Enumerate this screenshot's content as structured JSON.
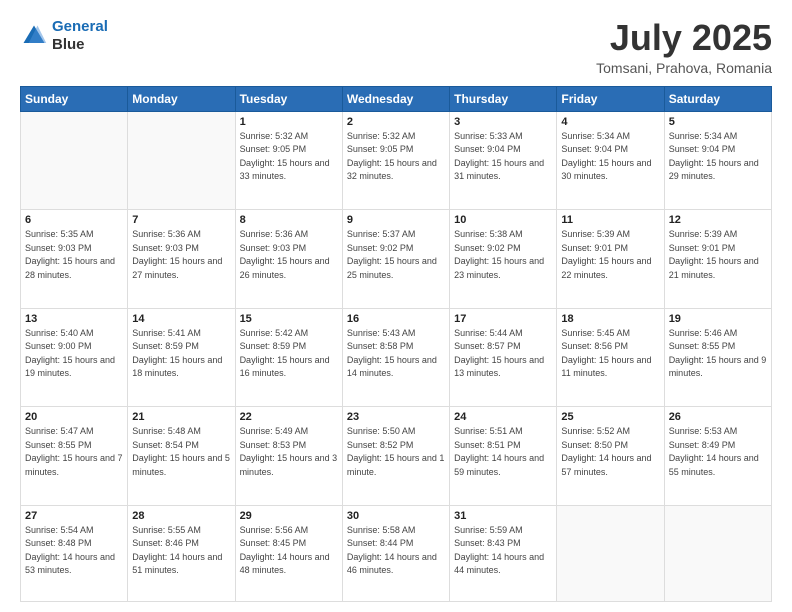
{
  "header": {
    "logo_line1": "General",
    "logo_line2": "Blue",
    "month": "July 2025",
    "location": "Tomsani, Prahova, Romania"
  },
  "weekdays": [
    "Sunday",
    "Monday",
    "Tuesday",
    "Wednesday",
    "Thursday",
    "Friday",
    "Saturday"
  ],
  "weeks": [
    [
      {
        "day": "",
        "sunrise": "",
        "sunset": "",
        "daylight": ""
      },
      {
        "day": "",
        "sunrise": "",
        "sunset": "",
        "daylight": ""
      },
      {
        "day": "1",
        "sunrise": "Sunrise: 5:32 AM",
        "sunset": "Sunset: 9:05 PM",
        "daylight": "Daylight: 15 hours and 33 minutes."
      },
      {
        "day": "2",
        "sunrise": "Sunrise: 5:32 AM",
        "sunset": "Sunset: 9:05 PM",
        "daylight": "Daylight: 15 hours and 32 minutes."
      },
      {
        "day": "3",
        "sunrise": "Sunrise: 5:33 AM",
        "sunset": "Sunset: 9:04 PM",
        "daylight": "Daylight: 15 hours and 31 minutes."
      },
      {
        "day": "4",
        "sunrise": "Sunrise: 5:34 AM",
        "sunset": "Sunset: 9:04 PM",
        "daylight": "Daylight: 15 hours and 30 minutes."
      },
      {
        "day": "5",
        "sunrise": "Sunrise: 5:34 AM",
        "sunset": "Sunset: 9:04 PM",
        "daylight": "Daylight: 15 hours and 29 minutes."
      }
    ],
    [
      {
        "day": "6",
        "sunrise": "Sunrise: 5:35 AM",
        "sunset": "Sunset: 9:03 PM",
        "daylight": "Daylight: 15 hours and 28 minutes."
      },
      {
        "day": "7",
        "sunrise": "Sunrise: 5:36 AM",
        "sunset": "Sunset: 9:03 PM",
        "daylight": "Daylight: 15 hours and 27 minutes."
      },
      {
        "day": "8",
        "sunrise": "Sunrise: 5:36 AM",
        "sunset": "Sunset: 9:03 PM",
        "daylight": "Daylight: 15 hours and 26 minutes."
      },
      {
        "day": "9",
        "sunrise": "Sunrise: 5:37 AM",
        "sunset": "Sunset: 9:02 PM",
        "daylight": "Daylight: 15 hours and 25 minutes."
      },
      {
        "day": "10",
        "sunrise": "Sunrise: 5:38 AM",
        "sunset": "Sunset: 9:02 PM",
        "daylight": "Daylight: 15 hours and 23 minutes."
      },
      {
        "day": "11",
        "sunrise": "Sunrise: 5:39 AM",
        "sunset": "Sunset: 9:01 PM",
        "daylight": "Daylight: 15 hours and 22 minutes."
      },
      {
        "day": "12",
        "sunrise": "Sunrise: 5:39 AM",
        "sunset": "Sunset: 9:01 PM",
        "daylight": "Daylight: 15 hours and 21 minutes."
      }
    ],
    [
      {
        "day": "13",
        "sunrise": "Sunrise: 5:40 AM",
        "sunset": "Sunset: 9:00 PM",
        "daylight": "Daylight: 15 hours and 19 minutes."
      },
      {
        "day": "14",
        "sunrise": "Sunrise: 5:41 AM",
        "sunset": "Sunset: 8:59 PM",
        "daylight": "Daylight: 15 hours and 18 minutes."
      },
      {
        "day": "15",
        "sunrise": "Sunrise: 5:42 AM",
        "sunset": "Sunset: 8:59 PM",
        "daylight": "Daylight: 15 hours and 16 minutes."
      },
      {
        "day": "16",
        "sunrise": "Sunrise: 5:43 AM",
        "sunset": "Sunset: 8:58 PM",
        "daylight": "Daylight: 15 hours and 14 minutes."
      },
      {
        "day": "17",
        "sunrise": "Sunrise: 5:44 AM",
        "sunset": "Sunset: 8:57 PM",
        "daylight": "Daylight: 15 hours and 13 minutes."
      },
      {
        "day": "18",
        "sunrise": "Sunrise: 5:45 AM",
        "sunset": "Sunset: 8:56 PM",
        "daylight": "Daylight: 15 hours and 11 minutes."
      },
      {
        "day": "19",
        "sunrise": "Sunrise: 5:46 AM",
        "sunset": "Sunset: 8:55 PM",
        "daylight": "Daylight: 15 hours and 9 minutes."
      }
    ],
    [
      {
        "day": "20",
        "sunrise": "Sunrise: 5:47 AM",
        "sunset": "Sunset: 8:55 PM",
        "daylight": "Daylight: 15 hours and 7 minutes."
      },
      {
        "day": "21",
        "sunrise": "Sunrise: 5:48 AM",
        "sunset": "Sunset: 8:54 PM",
        "daylight": "Daylight: 15 hours and 5 minutes."
      },
      {
        "day": "22",
        "sunrise": "Sunrise: 5:49 AM",
        "sunset": "Sunset: 8:53 PM",
        "daylight": "Daylight: 15 hours and 3 minutes."
      },
      {
        "day": "23",
        "sunrise": "Sunrise: 5:50 AM",
        "sunset": "Sunset: 8:52 PM",
        "daylight": "Daylight: 15 hours and 1 minute."
      },
      {
        "day": "24",
        "sunrise": "Sunrise: 5:51 AM",
        "sunset": "Sunset: 8:51 PM",
        "daylight": "Daylight: 14 hours and 59 minutes."
      },
      {
        "day": "25",
        "sunrise": "Sunrise: 5:52 AM",
        "sunset": "Sunset: 8:50 PM",
        "daylight": "Daylight: 14 hours and 57 minutes."
      },
      {
        "day": "26",
        "sunrise": "Sunrise: 5:53 AM",
        "sunset": "Sunset: 8:49 PM",
        "daylight": "Daylight: 14 hours and 55 minutes."
      }
    ],
    [
      {
        "day": "27",
        "sunrise": "Sunrise: 5:54 AM",
        "sunset": "Sunset: 8:48 PM",
        "daylight": "Daylight: 14 hours and 53 minutes."
      },
      {
        "day": "28",
        "sunrise": "Sunrise: 5:55 AM",
        "sunset": "Sunset: 8:46 PM",
        "daylight": "Daylight: 14 hours and 51 minutes."
      },
      {
        "day": "29",
        "sunrise": "Sunrise: 5:56 AM",
        "sunset": "Sunset: 8:45 PM",
        "daylight": "Daylight: 14 hours and 48 minutes."
      },
      {
        "day": "30",
        "sunrise": "Sunrise: 5:58 AM",
        "sunset": "Sunset: 8:44 PM",
        "daylight": "Daylight: 14 hours and 46 minutes."
      },
      {
        "day": "31",
        "sunrise": "Sunrise: 5:59 AM",
        "sunset": "Sunset: 8:43 PM",
        "daylight": "Daylight: 14 hours and 44 minutes."
      },
      {
        "day": "",
        "sunrise": "",
        "sunset": "",
        "daylight": ""
      },
      {
        "day": "",
        "sunrise": "",
        "sunset": "",
        "daylight": ""
      }
    ]
  ]
}
